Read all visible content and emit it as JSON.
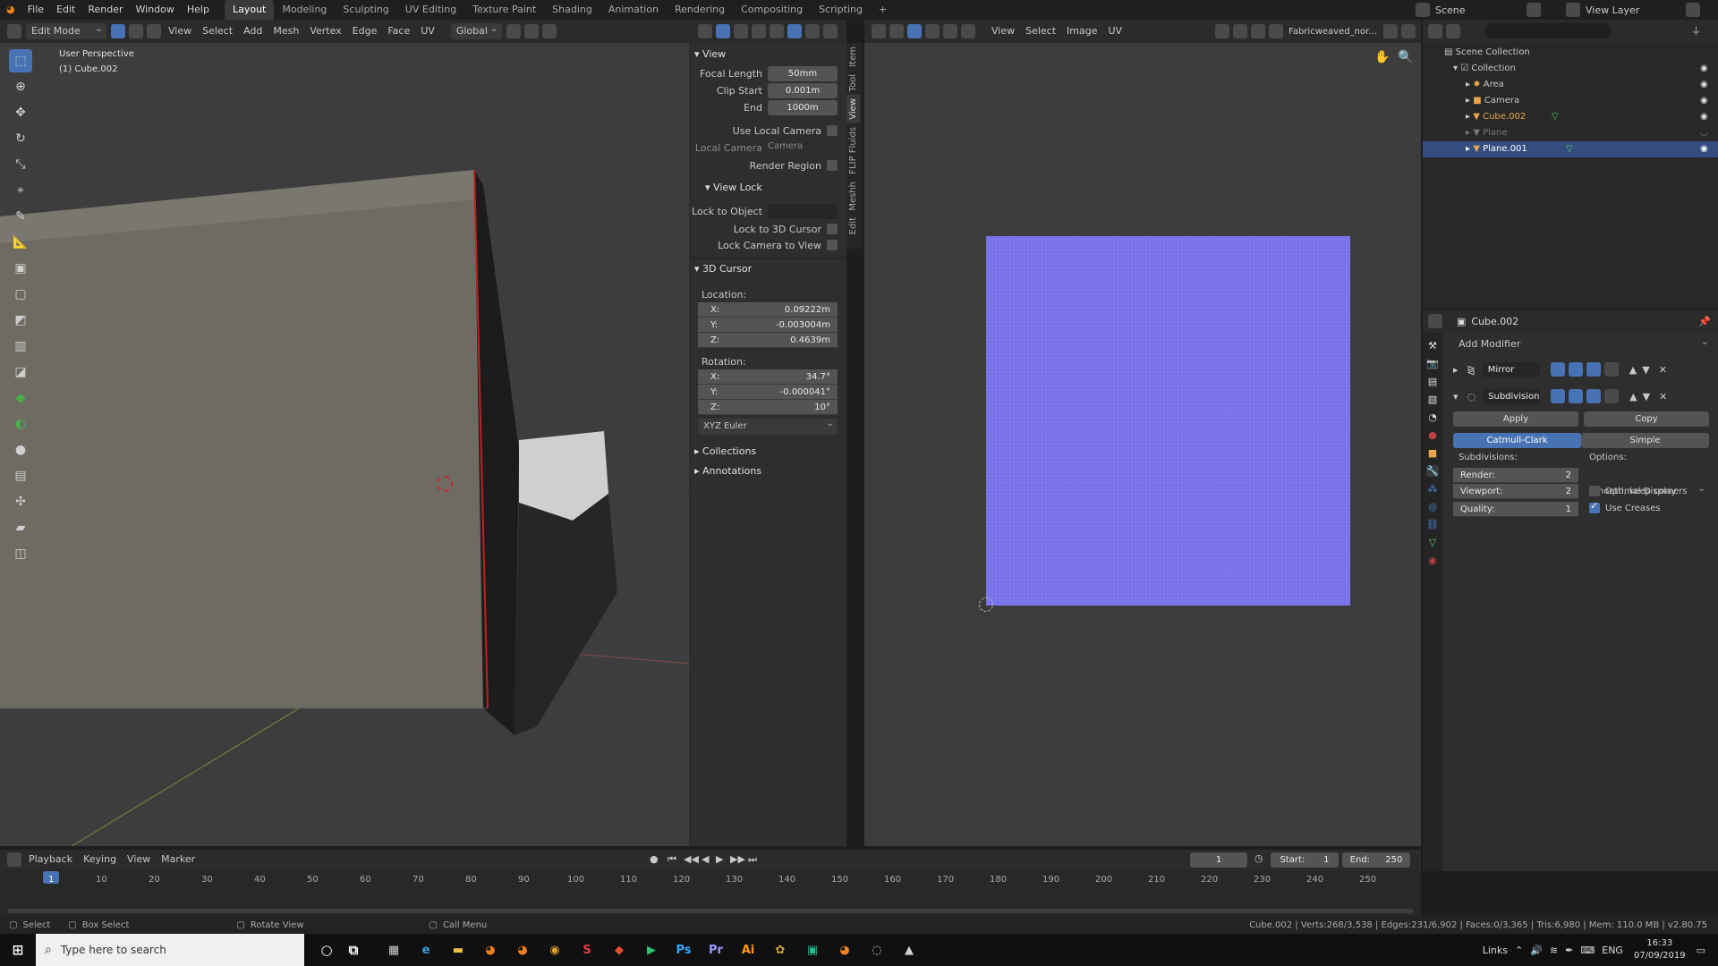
{
  "menu": {
    "items": [
      "File",
      "Edit",
      "Render",
      "Window",
      "Help"
    ]
  },
  "workspaces": [
    "Layout",
    "Modeling",
    "Sculpting",
    "UV Editing",
    "Texture Paint",
    "Shading",
    "Animation",
    "Rendering",
    "Compositing",
    "Scripting"
  ],
  "topright": {
    "scene": "Scene",
    "view_layer": "View Layer"
  },
  "viewport": {
    "mode": "Edit Mode",
    "menus": [
      "View",
      "Select",
      "Add",
      "Mesh",
      "Vertex",
      "Edge",
      "Face",
      "UV"
    ],
    "orientation": "Global",
    "info_line1": "User Perspective",
    "info_line2": "(1) Cube.002"
  },
  "npanel": {
    "tabs": [
      "Item",
      "Tool",
      "View",
      "FLIP Fluids",
      "Meshh",
      "Edit"
    ],
    "view_header": "View",
    "focal_length_label": "Focal Length",
    "focal_length": "50mm",
    "clip_start_label": "Clip Start",
    "clip_start": "0.001m",
    "end_label": "End",
    "end": "1000m",
    "use_local_camera": "Use Local Camera",
    "local_camera_label": "Local Camera",
    "local_camera": "Camera",
    "render_region": "Render Region",
    "view_lock_header": "View Lock",
    "lock_to_object": "Lock to Object",
    "lock_to_cursor": "Lock to 3D Cursor",
    "lock_camera": "Lock Camera to View",
    "cursor_header": "3D Cursor",
    "location_label": "Location:",
    "loc": [
      {
        "axis": "X:",
        "value": "0.09222m"
      },
      {
        "axis": "Y:",
        "value": "-0.003004m"
      },
      {
        "axis": "Z:",
        "value": "0.4639m"
      }
    ],
    "rotation_label": "Rotation:",
    "rot": [
      {
        "axis": "X:",
        "value": "34.7°"
      },
      {
        "axis": "Y:",
        "value": "-0.000041°"
      },
      {
        "axis": "Z:",
        "value": "10°"
      }
    ],
    "rotation_mode": "XYZ Euler",
    "collections": "Collections",
    "annotations": "Annotations"
  },
  "image_editor": {
    "menus": [
      "View",
      "Select",
      "Image",
      "UV"
    ],
    "image_name": "Fabricweaved_nor...",
    "image_color": "#7b73ee"
  },
  "outliner": {
    "root": "Scene Collection",
    "collection": "Collection",
    "items": [
      {
        "name": "Area",
        "icon": "light-icon",
        "color": "#c8c8c8"
      },
      {
        "name": "Camera",
        "icon": "camera-icon",
        "color": "#c8c8c8"
      },
      {
        "name": "Cube.002",
        "icon": "mesh-icon",
        "color": "#e8a54a"
      },
      {
        "name": "Plane",
        "icon": "mesh-icon",
        "color": "#7a7a7a"
      },
      {
        "name": "Plane.001",
        "icon": "mesh-icon",
        "color": "#e8e8e8"
      }
    ]
  },
  "properties": {
    "object": "Cube.002",
    "add_modifier": "Add Modifier",
    "mod1": "Mirror",
    "mod2": "Subdivision",
    "apply": "Apply",
    "copy": "Copy",
    "catmull": "Catmull-Clark",
    "simple": "Simple",
    "subdivisions": "Subdivisions:",
    "options": "Options:",
    "render_label": "Render:",
    "render_val": "2",
    "viewport_label": "Viewport:",
    "viewport_val": "2",
    "quality_label": "Quality:",
    "quality_val": "1",
    "uv_smooth": "Smooth, keep corners",
    "optimal_display": "Optimal Display",
    "use_creases": "Use Creases"
  },
  "timeline": {
    "menus": [
      "Playback",
      "Keying",
      "View",
      "Marker"
    ],
    "current": "1",
    "start_label": "Start:",
    "start": "1",
    "end_label": "End:",
    "end": "250",
    "ticks": [
      "1",
      "10",
      "20",
      "30",
      "40",
      "50",
      "60",
      "70",
      "80",
      "90",
      "100",
      "110",
      "120",
      "130",
      "140",
      "150",
      "160",
      "170",
      "180",
      "190",
      "200",
      "210",
      "220",
      "230",
      "240",
      "250"
    ]
  },
  "statusbar": {
    "select": "Select",
    "box_select": "Box Select",
    "rotate_view": "Rotate View",
    "call_menu": "Call Menu",
    "stats": "Cube.002 | Verts:268/3,538 | Edges:231/6,902 | Faces:0/3,365 | Tris:6,980 | Mem: 110.0 MB | v2.80.75"
  },
  "taskbar": {
    "search_placeholder": "Type here to search",
    "links": "Links",
    "lang": "ENG",
    "time": "16:33",
    "date": "07/09/2019",
    "apps": [
      {
        "name": "calculator-icon",
        "glyph": "▦",
        "color": "#d0d0d0"
      },
      {
        "name": "edge-icon",
        "glyph": "e",
        "color": "#3aa0e0"
      },
      {
        "name": "explorer-icon",
        "glyph": "▬",
        "color": "#f0c040"
      },
      {
        "name": "blender-icon",
        "glyph": "◕",
        "color": "#f08020"
      },
      {
        "name": "blender2-icon",
        "glyph": "◕",
        "color": "#f08020"
      },
      {
        "name": "chrome-icon",
        "glyph": "◉",
        "color": "#e0a030"
      },
      {
        "name": "app-red-icon",
        "glyph": "S",
        "color": "#e04040"
      },
      {
        "name": "app-orange-icon",
        "glyph": "◆",
        "color": "#e05030"
      },
      {
        "name": "play-icon",
        "glyph": "▶",
        "color": "#30c070"
      },
      {
        "name": "photoshop-icon",
        "glyph": "Ps",
        "color": "#31a8ff"
      },
      {
        "name": "premiere-icon",
        "glyph": "Pr",
        "color": "#9999ff"
      },
      {
        "name": "illustrator-icon",
        "glyph": "Ai",
        "color": "#ff9a00"
      },
      {
        "name": "app-multi-icon",
        "glyph": "✿",
        "color": "#d0a040"
      },
      {
        "name": "app-green-icon",
        "glyph": "▣",
        "color": "#20c090"
      },
      {
        "name": "blender3-icon",
        "glyph": "◕",
        "color": "#f08020"
      },
      {
        "name": "app-circle-icon",
        "glyph": "◌",
        "color": "#d0d0d0"
      },
      {
        "name": "photos-icon",
        "glyph": "▲",
        "color": "#d0d0d0"
      }
    ]
  }
}
